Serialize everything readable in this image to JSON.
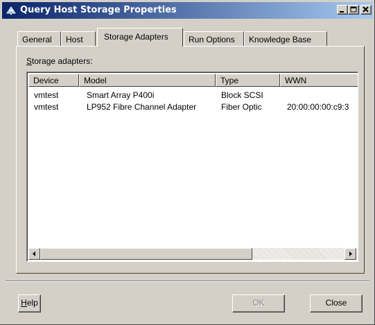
{
  "window": {
    "title": "Query Host Storage Properties"
  },
  "tabs": [
    {
      "label": "General",
      "active": false
    },
    {
      "label": "Host",
      "active": false
    },
    {
      "label": "Storage Adapters",
      "active": true
    },
    {
      "label": "Run Options",
      "active": false
    },
    {
      "label": "Knowledge Base",
      "active": false
    }
  ],
  "storage_adapters": {
    "label_prefix": "S",
    "label_rest": "torage adapters:",
    "columns": [
      "Device",
      "Model",
      "Type",
      "WWN"
    ],
    "rows": [
      {
        "device": "vmtest",
        "model": "Smart Array P400i",
        "type": "Block SCSI",
        "wwn": ""
      },
      {
        "device": "vmtest",
        "model": "LP952 Fibre Channel Adapter",
        "type": "Fiber Optic",
        "wwn": "20:00:00:00:c9:3"
      }
    ]
  },
  "buttons": {
    "help_prefix": "H",
    "help_rest": "elp",
    "ok": "OK",
    "close": "Close"
  },
  "colors": {
    "titlebar_start": "#0a246a",
    "titlebar_end": "#a6caf0",
    "face": "#d4d0c8"
  }
}
